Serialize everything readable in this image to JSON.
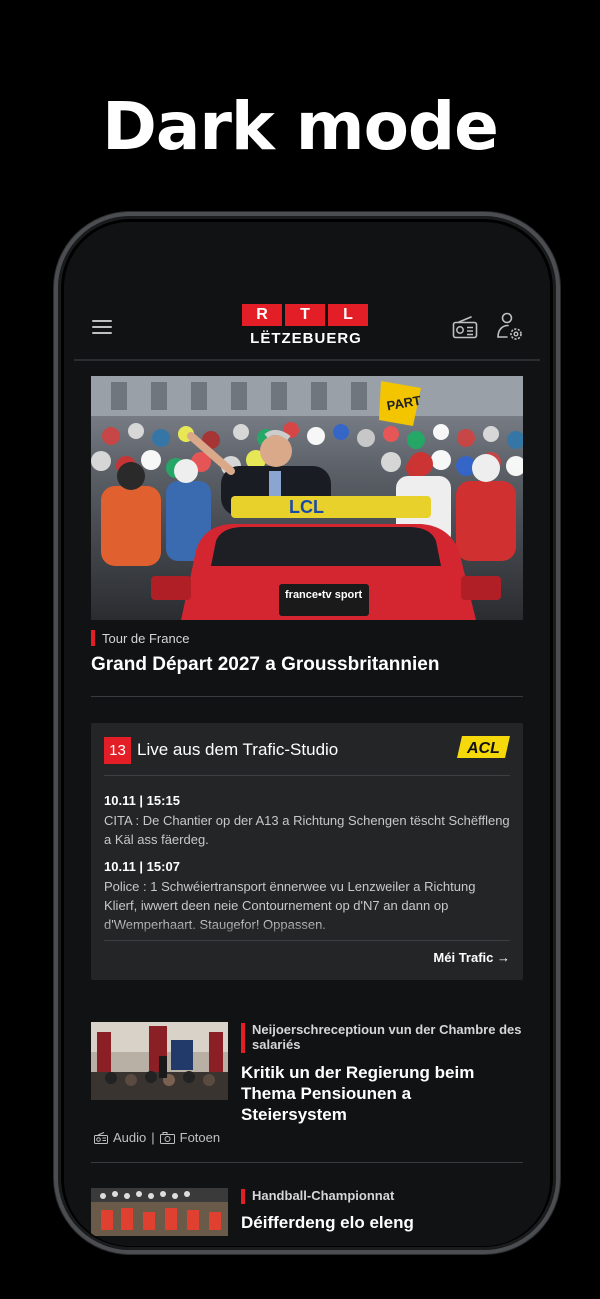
{
  "promo": {
    "title": "Dark mode"
  },
  "header": {
    "logo_letters": [
      "R",
      "T",
      "L"
    ],
    "logo_subtitle": "LËTZEBUERG",
    "icons": [
      "hamburger-menu-icon",
      "radio-icon",
      "user-settings-icon"
    ]
  },
  "hero": {
    "kicker": "Tour de France",
    "title": "Grand Départ 2027 a Groussbritannien",
    "image_text": {
      "flag": "PART",
      "car_top": "LCL",
      "car_badge": "france•tv sport"
    }
  },
  "traffic": {
    "badge": "13",
    "title": "Live aus dem Trafic-Studio",
    "sponsor": "ACL",
    "items": [
      {
        "time": "10.11 | 15:15",
        "text": "CITA : De Chantier op der A13 a Richtung Schengen tëscht Schëffleng a Käl ass fäerdeg."
      },
      {
        "time": "10.11 | 15:07",
        "text": "Police : 1 Schwéiertransport ënnerwee vu Lenzweiler a Richtung Klierf, iwwert deen neie Contournement op d'N7 an dann op d'Wemperhaart. Staugefor! Oppassen."
      }
    ],
    "more_label": "Méi Trafic →"
  },
  "articles": [
    {
      "kicker": "Neijoerschreceptioun vun der Chambre des salariés",
      "title": "Kritik un der Regierung beim Thema Pensiounen a Steiersystem",
      "meta": {
        "audio": "Audio",
        "separator": "|",
        "photos": "Fotoen"
      }
    },
    {
      "kicker": "Handball-Championnat",
      "title": "Déifferdeng elo eleng"
    }
  ],
  "colors": {
    "accent": "#e41e26",
    "background": "#111214",
    "card": "#242527",
    "acl": "#f5d90a"
  }
}
